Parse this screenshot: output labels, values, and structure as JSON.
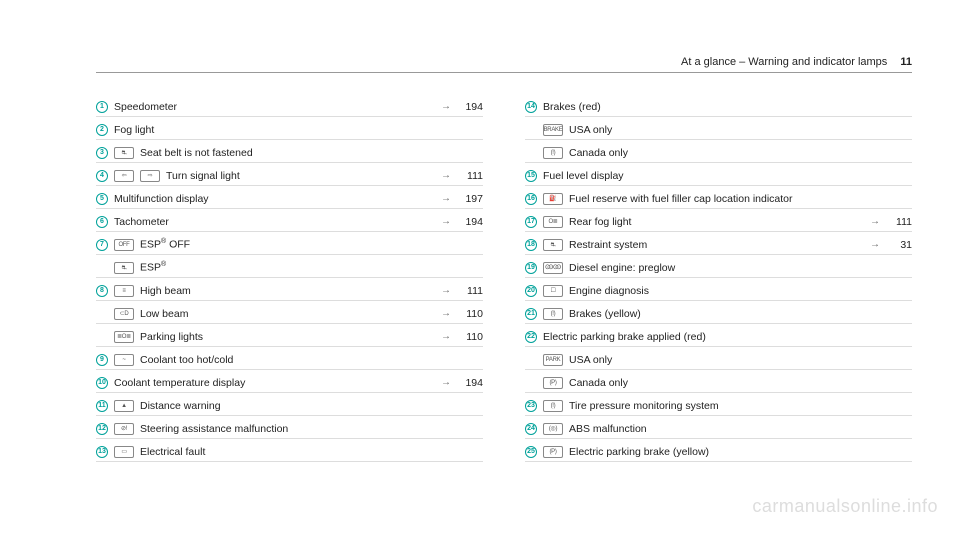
{
  "header": {
    "section": "At a glance – Warning and indicator lamps",
    "page": "11"
  },
  "watermark": "carmanualsonline.info",
  "arrow": "→",
  "left": [
    {
      "num": "1",
      "icons": [],
      "label": "Speedometer",
      "page": "194"
    },
    {
      "num": "2",
      "icons": [],
      "label": "Fog light",
      "page": ""
    },
    {
      "num": "3",
      "icons": [
        "⛐"
      ],
      "label": "Seat belt is not fastened",
      "page": ""
    },
    {
      "num": "4",
      "icons": [
        "⇦",
        "⇨"
      ],
      "label": "Turn signal light",
      "page": "111"
    },
    {
      "num": "5",
      "icons": [],
      "label": "Multifunction display",
      "page": "197"
    },
    {
      "num": "6",
      "icons": [],
      "label": "Tachometer",
      "page": "194"
    },
    {
      "num": "7",
      "icons": [
        "OFF"
      ],
      "label": "ESP® OFF",
      "page": ""
    },
    {
      "num": "",
      "icons": [
        "⛐"
      ],
      "label": "ESP®",
      "page": ""
    },
    {
      "num": "8",
      "icons": [
        "≡"
      ],
      "label": "High beam",
      "page": "111"
    },
    {
      "num": "",
      "icons": [
        "⊂D"
      ],
      "label": "Low beam",
      "page": "110"
    },
    {
      "num": "",
      "icons": [
        "≣O≣"
      ],
      "label": "Parking lights",
      "page": "110"
    },
    {
      "num": "9",
      "icons": [
        "~"
      ],
      "label": "Coolant too hot/cold",
      "page": ""
    },
    {
      "num": "10",
      "icons": [],
      "label": "Coolant temperature display",
      "page": "194"
    },
    {
      "num": "11",
      "icons": [
        "▲"
      ],
      "label": "Distance warning",
      "page": ""
    },
    {
      "num": "12",
      "icons": [
        "⊘!"
      ],
      "label": "Steering assistance malfunction",
      "page": ""
    },
    {
      "num": "13",
      "icons": [
        "▭"
      ],
      "label": "Electrical fault",
      "page": ""
    }
  ],
  "right": [
    {
      "num": "14",
      "icons": [],
      "label": "Brakes (red)",
      "page": ""
    },
    {
      "num": "",
      "icons": [
        "BRAKE"
      ],
      "label": "USA only",
      "page": ""
    },
    {
      "num": "",
      "icons": [
        "(!)"
      ],
      "label": "Canada only",
      "page": ""
    },
    {
      "num": "15",
      "icons": [],
      "label": "Fuel level display",
      "page": ""
    },
    {
      "num": "16",
      "icons": [
        "⛽"
      ],
      "label": "Fuel reserve with fuel filler cap location indicator",
      "page": ""
    },
    {
      "num": "17",
      "icons": [
        "O≣"
      ],
      "label": "Rear fog light",
      "page": "111"
    },
    {
      "num": "18",
      "icons": [
        "⛐"
      ],
      "label": "Restraint system",
      "page": "31"
    },
    {
      "num": "19",
      "icons": [
        "ꙬꙬ"
      ],
      "label": "Diesel engine: preglow",
      "page": ""
    },
    {
      "num": "20",
      "icons": [
        "☐"
      ],
      "label": "Engine diagnosis",
      "page": ""
    },
    {
      "num": "21",
      "icons": [
        "(!)"
      ],
      "label": "Brakes (yellow)",
      "page": ""
    },
    {
      "num": "22",
      "icons": [],
      "label": "Electric parking brake applied (red)",
      "page": ""
    },
    {
      "num": "",
      "icons": [
        "PARK"
      ],
      "label": "USA only",
      "page": ""
    },
    {
      "num": "",
      "icons": [
        "(P)"
      ],
      "label": "Canada only",
      "page": ""
    },
    {
      "num": "23",
      "icons": [
        "(!)"
      ],
      "label": "Tire pressure monitoring system",
      "page": ""
    },
    {
      "num": "24",
      "icons": [
        "(◎)"
      ],
      "label": "ABS malfunction",
      "page": ""
    },
    {
      "num": "25",
      "icons": [
        "(P)"
      ],
      "label": "Electric parking brake (yellow)",
      "page": ""
    }
  ]
}
